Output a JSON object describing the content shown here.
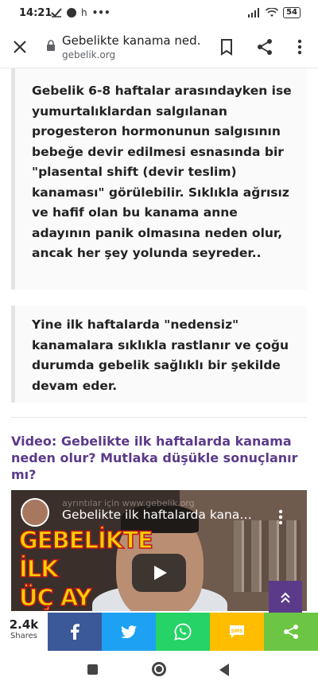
{
  "status_bar": {
    "time": "14:21",
    "extra": "h",
    "dots": "•••",
    "battery": "54"
  },
  "browser": {
    "title": "Gebelikte kanama ned…",
    "domain": "gebelik.org"
  },
  "article": {
    "quote1": "Gebelik 6-8 haftalar arasındayken ise yumurtalıklardan salgılanan progesteron hormonunun salgısının bebeğe devir edilmesi esnasında bir \"plasental shift (devir teslim) kanaması\" görülebilir. Sıklıkla ağrısız ve hafif olan bu kanama anne adayının panik olmasına neden olur, ancak her şey yolunda seyreder..",
    "quote2": "Yine ilk haftalarda \"nedensiz\" kanamalara sıklıkla rastlanır ve çoğu durumda gebelik sağlıklı bir şekilde devam eder.",
    "video_heading": "Video: Gebelikte ilk haftalarda kanama neden olur? Mutlaka düşükle sonuçlanır mı?"
  },
  "video": {
    "title": "Gebelikte ilk haftalarda kana…",
    "faint_text": "ayrıntılar için www.gebelik.org",
    "overlay_lines": [
      "GEBELİKTE",
      "İLK",
      "ÜÇ AY"
    ]
  },
  "scroll_top_icon": "double-chevron-up-icon",
  "share": {
    "count": "2.4k",
    "label": "Shares",
    "sms_label": "SMS",
    "colors": {
      "facebook": "#3b5998",
      "twitter": "#1da1f2",
      "whatsapp": "#25d366",
      "sms": "#ffbd00",
      "share": "#6cc644"
    }
  },
  "accent_color": "#5b3a8a"
}
